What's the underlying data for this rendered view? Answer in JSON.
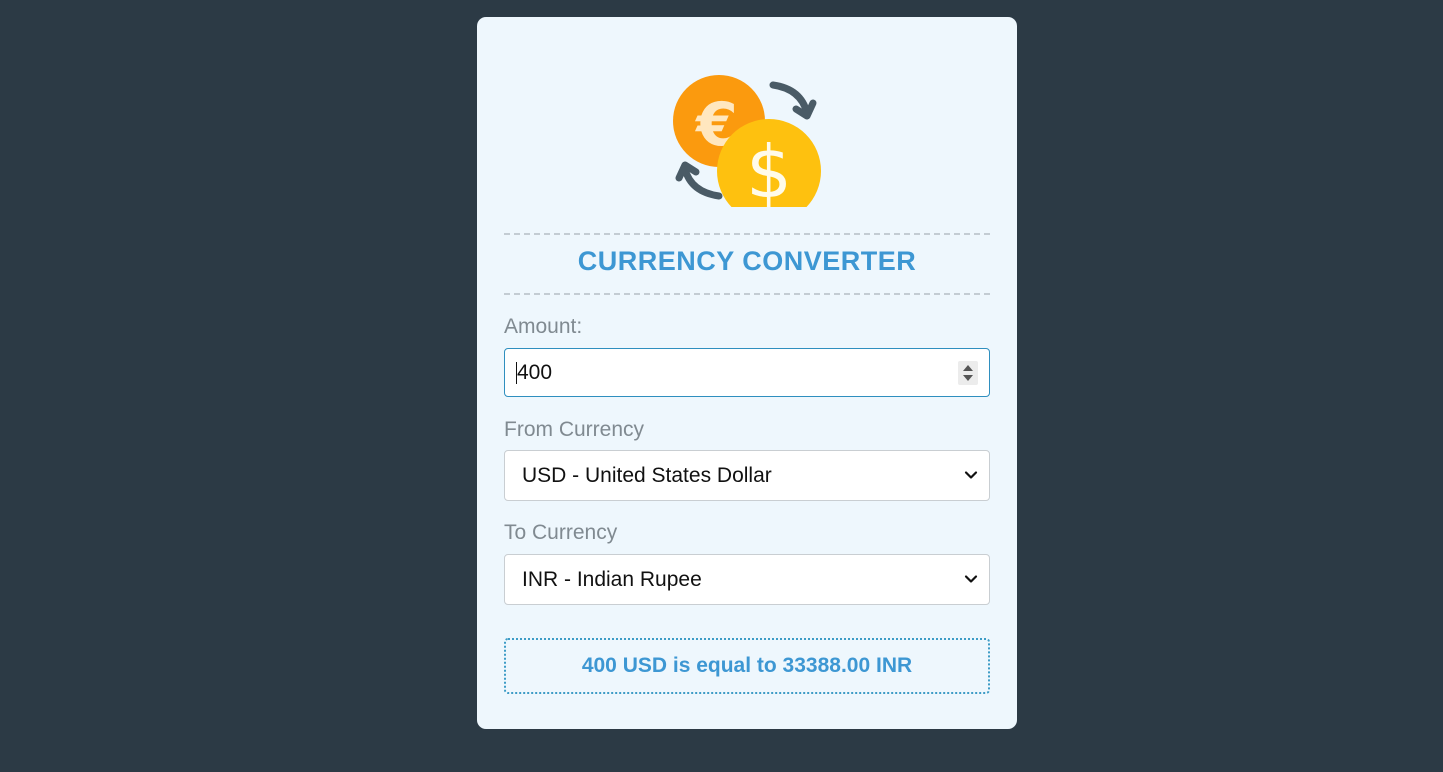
{
  "app": {
    "title": "CURRENCY CONVERTER",
    "logo_icon": "currency-exchange-icon"
  },
  "form": {
    "amount_label": "Amount:",
    "amount_value": "400",
    "from_label": "From Currency",
    "from_selected": "USD - United States Dollar",
    "to_label": "To Currency",
    "to_selected": "INR - Indian Rupee"
  },
  "result": {
    "text": "400 USD is equal to 33388.00 INR"
  },
  "colors": {
    "background": "#2c3a45",
    "card": "#eef7fd",
    "accent": "#3d97d3",
    "euro_coin": "#fb9a0e",
    "dollar_coin": "#fec10f",
    "arrows": "#4a5b66"
  }
}
